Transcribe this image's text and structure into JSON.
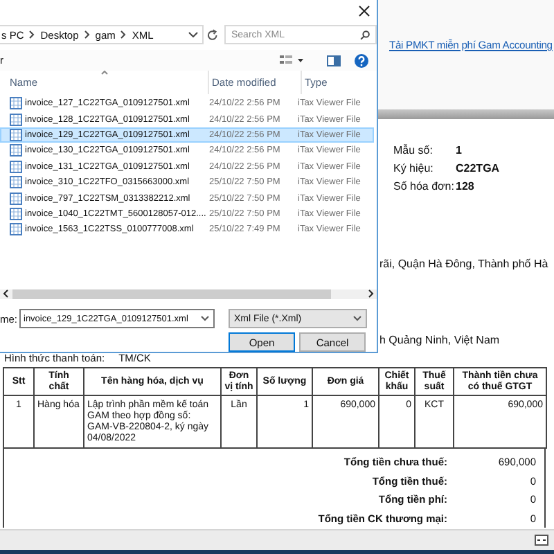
{
  "dialog": {
    "breadcrumb": [
      "s PC",
      "Desktop",
      "gam",
      "XML"
    ],
    "search": {
      "placeholder": "Search XML"
    },
    "toolbar_label": "r",
    "columns": [
      "Name",
      "Date modified",
      "Type"
    ],
    "files": [
      {
        "name": "invoice_127_1C22TGA_0109127501.xml",
        "date": "24/10/22 2:56 PM",
        "type": "iTax Viewer File",
        "selected": false
      },
      {
        "name": "invoice_128_1C22TGA_0109127501.xml",
        "date": "24/10/22 2:56 PM",
        "type": "iTax Viewer File",
        "selected": false
      },
      {
        "name": "invoice_129_1C22TGA_0109127501.xml",
        "date": "24/10/22 2:56 PM",
        "type": "iTax Viewer File",
        "selected": true
      },
      {
        "name": "invoice_130_1C22TGA_0109127501.xml",
        "date": "24/10/22 2:56 PM",
        "type": "iTax Viewer File",
        "selected": false
      },
      {
        "name": "invoice_131_1C22TGA_0109127501.xml",
        "date": "24/10/22 2:56 PM",
        "type": "iTax Viewer File",
        "selected": false
      },
      {
        "name": "invoice_310_1C22TFO_0315663000.xml",
        "date": "25/10/22 7:50 PM",
        "type": "iTax Viewer File",
        "selected": false
      },
      {
        "name": "invoice_797_1C22TSM_0313382212.xml",
        "date": "25/10/22 7:50 PM",
        "type": "iTax Viewer File",
        "selected": false
      },
      {
        "name": "invoice_1040_1C22TMT_5600128057-012....",
        "date": "25/10/22 7:50 PM",
        "type": "iTax Viewer File",
        "selected": false
      },
      {
        "name": "invoice_1563_1C22TSS_0100777008.xml",
        "date": "25/10/22 7:49 PM",
        "type": "iTax Viewer File",
        "selected": false
      }
    ],
    "file_name_label": "me:",
    "file_name": "invoice_129_1C22TGA_0109127501.xml",
    "file_type": "Xml File (*.Xml)",
    "buttons": [
      "Open",
      "Cancel"
    ]
  },
  "document": {
    "link": "Tải PMKT miễn phí Gam Accounting",
    "fields": [
      {
        "label": "Mẫu số:",
        "value": "1"
      },
      {
        "label": "Ký hiệu:",
        "value": "C22TGA"
      },
      {
        "label": "Số hóa đơn:",
        "value": "128"
      }
    ],
    "address_1": "rãi, Quận Hà Đông, Thành phố Hà",
    "address_2": "h Quảng Ninh, Việt Nam",
    "payment": {
      "label": "Hình thức thanh toán:",
      "value": "TM/CK"
    },
    "table": {
      "columns": [
        "Stt",
        "Tính chất",
        "Tên hàng hóa, dịch vụ",
        "Đơn vị tính",
        "Số lượng",
        "Đơn giá",
        "Chiết khấu",
        "Thuế suất",
        "Thành tiền chưa có thuế GTGT"
      ],
      "rows": [
        [
          "1",
          "Hàng hóa",
          "Lập trình phần mềm kế toán GAM theo hợp đồng số: GAM-VB-220804-2, ký ngày 04/08/2022",
          "Lần",
          "1",
          "690,000",
          "0",
          "KCT",
          "690,000"
        ]
      ]
    },
    "totals": [
      {
        "label": "Tổng tiền chưa thuế:",
        "value": "690,000"
      },
      {
        "label": "Tổng tiền thuế:",
        "value": "0"
      },
      {
        "label": "Tổng tiền phí:",
        "value": "0"
      },
      {
        "label": "Tổng tiền CK thương mại:",
        "value": "0"
      }
    ]
  }
}
